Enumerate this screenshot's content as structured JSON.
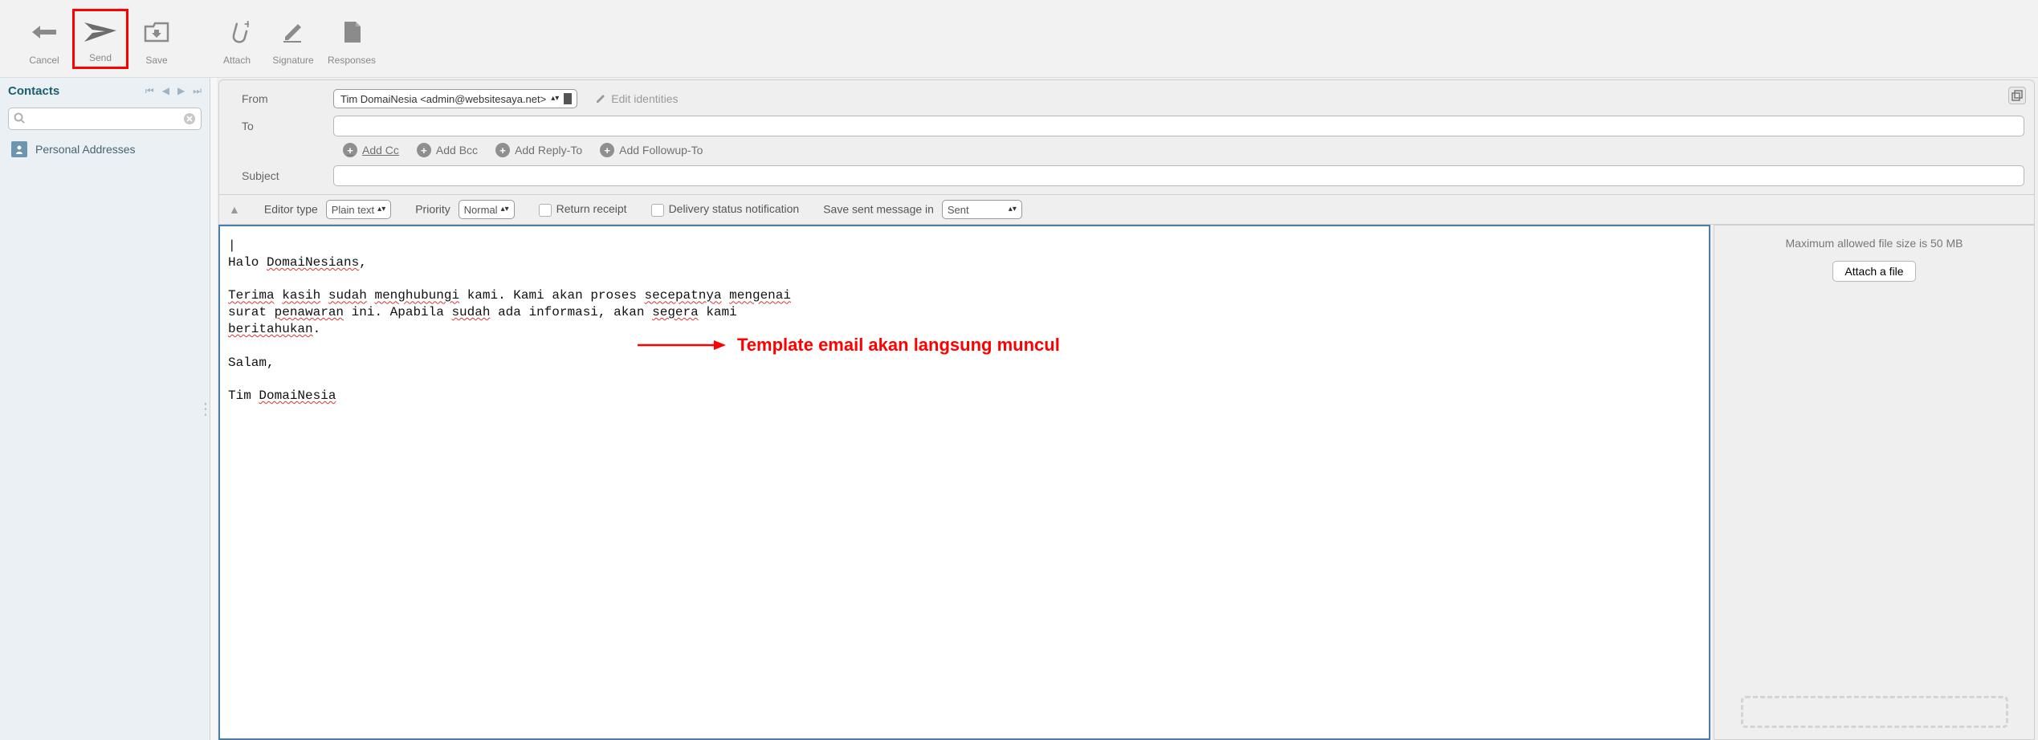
{
  "toolbar": {
    "cancel": "Cancel",
    "send": "Send",
    "save": "Save",
    "attach": "Attach",
    "signature": "Signature",
    "responses": "Responses"
  },
  "sidebar": {
    "title": "Contacts",
    "search_placeholder": "",
    "items": [
      {
        "label": "Personal Addresses"
      }
    ]
  },
  "compose": {
    "from_label": "From",
    "from_value": "Tim DomaiNesia <admin@websitesaya.net>",
    "edit_identities": "Edit identities",
    "to_label": "To",
    "subject_label": "Subject",
    "add_cc": "Add Cc",
    "add_bcc": "Add Bcc",
    "add_replyto": "Add Reply-To",
    "add_followupto": "Add Followup-To"
  },
  "options": {
    "editor_type_label": "Editor type",
    "editor_type_value": "Plain text",
    "priority_label": "Priority",
    "priority_value": "Normal",
    "return_receipt": "Return receipt",
    "dsn": "Delivery status notification",
    "save_sent_label": "Save sent message in",
    "save_sent_value": "Sent"
  },
  "body": {
    "line1": "|",
    "line2a": "Halo ",
    "line2b": "DomaiNesians",
    "line2c": ",",
    "line4a": "Terima",
    "line4b": " ",
    "line4c": "kasih",
    "line4d": " ",
    "line4e": "sudah",
    "line4f": " ",
    "line4g": "menghubungi",
    "line4h": " kami. Kami akan proses ",
    "line4i": "secepatnya",
    "line4j": " ",
    "line4k": "mengenai",
    "line5a": "surat ",
    "line5b": "penawaran",
    "line5c": " ini. Apabila ",
    "line5d": "sudah",
    "line5e": " ada informasi, akan ",
    "line5f": "segera",
    "line5g": " kami",
    "line6a": "beritahukan",
    "line6b": ".",
    "line8": "Salam,",
    "line10a": "Tim ",
    "line10b": "DomaiNesia"
  },
  "attachments": {
    "max_text": "Maximum allowed file size is 50 MB",
    "button": "Attach a file"
  },
  "annotation": {
    "text": "Template email akan langsung muncul"
  }
}
